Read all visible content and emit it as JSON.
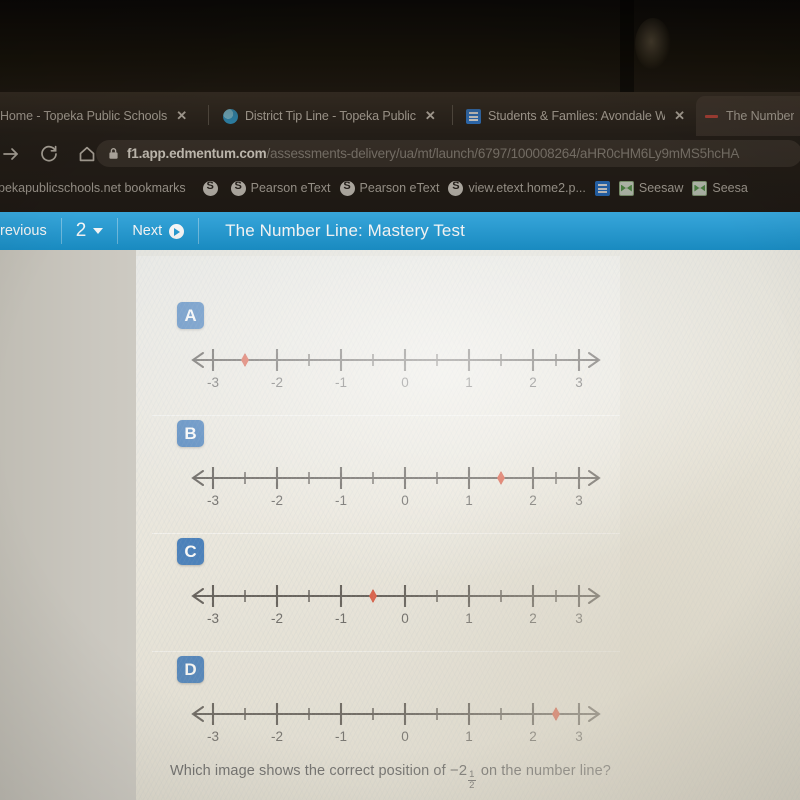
{
  "browser": {
    "tabs": [
      {
        "title": "Home - Topeka Public Schools",
        "favicon": "globe-icon",
        "close": "✕",
        "active": false
      },
      {
        "title": "District Tip Line - Topeka Public",
        "favicon": "globe-icon",
        "close": "✕",
        "active": false
      },
      {
        "title": "Students & Famlies: Avondale W",
        "favicon": "doc-icon",
        "close": "✕",
        "active": false
      },
      {
        "title": "The Number",
        "favicon": "dash-icon",
        "close": "",
        "active": true
      }
    ],
    "nav": {
      "forward": "forward-arrow-icon",
      "reload": "reload-icon",
      "home": "home-icon",
      "lock": "lock-icon"
    },
    "url": {
      "domain": "f1.app.edmentum.com",
      "path": "/assessments-delivery/ua/mt/launch/6797/100008264/aHR0cHM6Ly9mMS5hcHA"
    },
    "bookmarks": [
      {
        "label": "pekapublicschools.net bookmarks",
        "icon": ""
      },
      {
        "label": "",
        "icon": "pearson-icon"
      },
      {
        "label": "Pearson eText",
        "icon": "pearson-icon"
      },
      {
        "label": "Pearson eText",
        "icon": "pearson-icon"
      },
      {
        "label": "view.etext.home2.p...",
        "icon": "pearson-icon"
      },
      {
        "label": "",
        "icon": "doc-icon"
      },
      {
        "label": "Seesaw",
        "icon": "seesaw-icon"
      },
      {
        "label": "Seesa",
        "icon": "seesaw-icon"
      }
    ]
  },
  "appbar": {
    "previous_label": "revious",
    "question_number": "2",
    "next_label": "Next",
    "title": "The Number Line: Mastery Test",
    "accent_color": "#1c9ad6"
  },
  "question": {
    "text_before": "Which image shows the correct position of",
    "value_sign": "−",
    "value_whole": "2",
    "value_numerator": "1",
    "value_denominator": "2",
    "text_after": "on the number line?"
  },
  "chart_data": {
    "type": "scatter",
    "title": "The Number Line: Mastery Test",
    "xlabel": "",
    "ylabel": "",
    "xlim": [
      -3.5,
      3.5
    ],
    "xticks": [
      -3,
      -2,
      -1,
      0,
      1,
      2,
      3
    ],
    "xticklabels": [
      "-3",
      "-2",
      "-1",
      "0",
      "1",
      "2",
      "3"
    ],
    "minor_tick_step": 0.5,
    "grid": false,
    "legend": null,
    "marker_color": "#d9462c",
    "axis_color": "#4c4742",
    "series": [
      {
        "name": "A",
        "values": [
          -2.5
        ]
      },
      {
        "name": "B",
        "values": [
          1.5
        ]
      },
      {
        "name": "C",
        "values": [
          -0.5
        ]
      },
      {
        "name": "D",
        "values": [
          2.5
        ]
      }
    ]
  },
  "options": [
    {
      "label": "A",
      "marker_value": -2.5
    },
    {
      "label": "B",
      "marker_value": 1.5
    },
    {
      "label": "C",
      "marker_value": -0.5
    },
    {
      "label": "D",
      "marker_value": 2.5
    }
  ],
  "colors": {
    "badge": "#2f6fb5",
    "marker": "#d9462c",
    "paper": "#e6e2d6",
    "chrome": "#241e18"
  }
}
